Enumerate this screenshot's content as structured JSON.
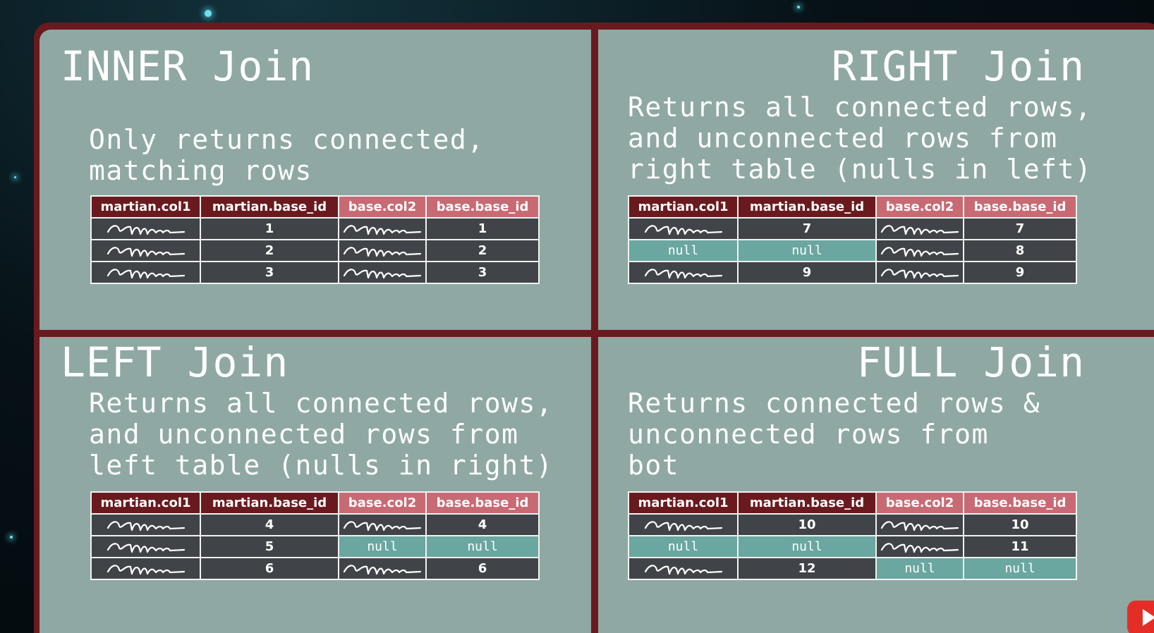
{
  "panels": {
    "inner": {
      "title": "INNER Join",
      "desc_lines": [
        "Only returns connected,",
        "matching rows"
      ],
      "headers": [
        "martian.col1",
        "martian.base_id",
        "base.col2",
        "base.base_id"
      ],
      "rows": [
        [
          "~",
          "1",
          "~",
          "1"
        ],
        [
          "~",
          "2",
          "~",
          "2"
        ],
        [
          "~",
          "3",
          "~",
          "3"
        ]
      ]
    },
    "right": {
      "title": "RIGHT Join",
      "desc_lines": [
        "Returns all connected rows,",
        "and unconnected rows from",
        "right table (nulls in left)"
      ],
      "headers": [
        "martian.col1",
        "martian.base_id",
        "base.col2",
        "base.base_id"
      ],
      "rows": [
        [
          "~",
          "7",
          "~",
          "7"
        ],
        [
          "null",
          "null",
          "~",
          "8"
        ],
        [
          "~",
          "9",
          "~",
          "9"
        ]
      ]
    },
    "left": {
      "title": "LEFT Join",
      "desc_lines": [
        "Returns all connected rows,",
        "and unconnected rows from",
        "left table (nulls in right)"
      ],
      "headers": [
        "martian.col1",
        "martian.base_id",
        "base.col2",
        "base.base_id"
      ],
      "rows": [
        [
          "~",
          "4",
          "~",
          "4"
        ],
        [
          "~",
          "5",
          "null",
          "null"
        ],
        [
          "~",
          "6",
          "~",
          "6"
        ]
      ]
    },
    "full": {
      "title": "FULL Join",
      "desc_lines": [
        "Returns connected rows &",
        "unconnected rows from",
        "bot"
      ],
      "headers": [
        "martian.col1",
        "martian.base_id",
        "base.col2",
        "base.base_id"
      ],
      "rows": [
        [
          "~",
          "10",
          "~",
          "10"
        ],
        [
          "null",
          "null",
          "~",
          "11"
        ],
        [
          "~",
          "12",
          "null",
          "null"
        ]
      ]
    }
  },
  "icons": {
    "squiggle": "handwritten-squiggle-icon",
    "video_logo": "play-button-icon"
  },
  "colors": {
    "frame": "#6a1a1e",
    "panel": "#8fa8a3",
    "header_martian": "#6a1a1e",
    "header_base": "#c86a74",
    "cell": "#404448",
    "null_cell": "#6aa7a0"
  }
}
